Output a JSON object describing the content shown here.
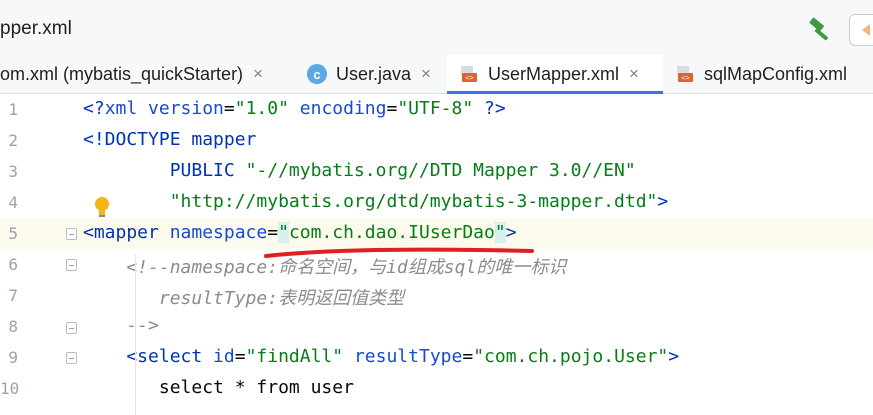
{
  "window": {
    "title": "pper.xml"
  },
  "toolbar": {
    "build_icon": "hammer-icon",
    "nav_icon": "back-arrow-icon"
  },
  "tabs": [
    {
      "label": "om.xml (mybatis_quickStarter)",
      "close": "×",
      "icon": "xml-icon",
      "active": false
    },
    {
      "label": "User.java",
      "close": "×",
      "icon": "class-c-icon",
      "active": false
    },
    {
      "label": "UserMapper.xml",
      "close": "×",
      "icon": "xml-icon",
      "active": true
    },
    {
      "label": "sqlMapConfig.xml",
      "close": "×",
      "icon": "xml-icon",
      "active": false
    }
  ],
  "editor": {
    "line_numbers": [
      "1",
      "2",
      "3",
      "4",
      "5",
      "6",
      "7",
      "8",
      "9",
      "10"
    ],
    "lines": {
      "l1": {
        "a": "<?",
        "b": "xml version",
        "c": "=",
        "d": "\"1.0\"",
        "e": " encoding",
        "f": "=",
        "g": "\"UTF-8\"",
        "h": " ?>"
      },
      "l2": {
        "a": "<!DOCTYPE mapper"
      },
      "l3": {
        "a": "        PUBLIC ",
        "b": "\"-//mybatis.org//DTD Mapper 3.0//EN\""
      },
      "l4": {
        "a": "        ",
        "b": "\"http://mybatis.org/dtd/mybatis-3-mapper.dtd\"",
        "c": ">"
      },
      "l5": {
        "a": "<mapper ",
        "b": "namespace",
        "c": "=",
        "d": "\"",
        "e": "com.ch.dao.IUserDao",
        "f": "\"",
        "g": ">"
      },
      "l6": {
        "a": "    <!--namespace:命名空间，与id组成sql的唯一标识"
      },
      "l7": {
        "a": "       resultType:表明返回值类型"
      },
      "l8": {
        "a": "    -->"
      },
      "l9": {
        "a": "    <select ",
        "b": "id",
        "c": "=",
        "d": "\"findAll\"",
        "e": " resultType",
        "f": "=",
        "g": "\"com.ch.pojo.User\"",
        "h": ">"
      },
      "l10": {
        "a": "       select * from user"
      }
    }
  },
  "colors": {
    "tag": "#0033b3",
    "attribute": "#174ad4",
    "value": "#067d17",
    "comment": "#8c8c8c",
    "tab_underline": "#3574f0",
    "annotation": "#e02020"
  }
}
